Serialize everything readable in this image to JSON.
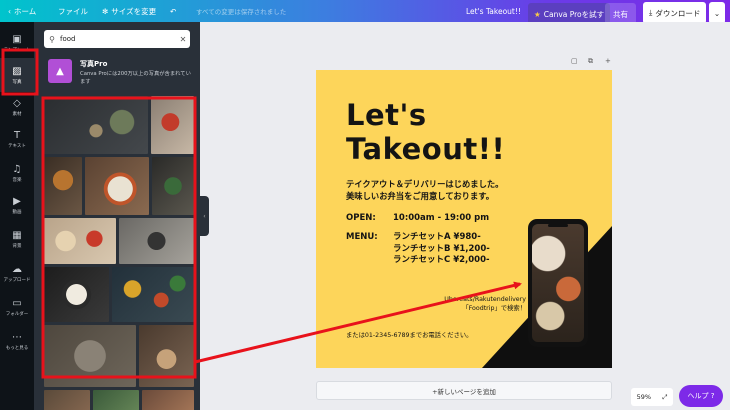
{
  "topbar": {
    "home": "ホーム",
    "file": "ファイル",
    "resize": "サイズを変更",
    "save_status": "すべての変更は保存されました",
    "doc_title": "Let's Takeout!!",
    "canva_pro": "Canva Proを試す",
    "share": "共有",
    "download": "ダウンロード"
  },
  "leftnav": {
    "items": [
      {
        "label": "テンプレート",
        "icon": "template-icon"
      },
      {
        "label": "写真",
        "icon": "photo-icon"
      },
      {
        "label": "素材",
        "icon": "elements-icon"
      },
      {
        "label": "テキスト",
        "icon": "text-icon"
      },
      {
        "label": "音楽",
        "icon": "music-icon"
      },
      {
        "label": "動画",
        "icon": "video-icon"
      },
      {
        "label": "背景",
        "icon": "background-icon"
      },
      {
        "label": "アップロード",
        "icon": "upload-icon"
      },
      {
        "label": "フォルダー",
        "icon": "folder-icon"
      },
      {
        "label": "もっと見る",
        "icon": "more-icon"
      }
    ]
  },
  "panel": {
    "search_value": "food",
    "promo_title": "写真Pro",
    "promo_desc": "Canva Proには200万以上の写真が含まれています"
  },
  "design": {
    "title_line1": "Let's",
    "title_line2": "Takeout!!",
    "intro_line1": "テイクアウト＆デリバリーはじめました。",
    "intro_line2": "美味しいお弁当をご用意しております。",
    "open_label": "OPEN:",
    "open_value": "10:00am - 19:00 pm",
    "menu_label": "MENU:",
    "menu_items": [
      "ランチセットA ¥980-",
      "ランチセットB ¥1,200-",
      "ランチセットC ¥2,000-"
    ],
    "handle_line1": "Ubereats/Rakutendelivery",
    "handle_line2": "「Foodtrip」で検索！",
    "contact": "または01-2345-6789までお電話ください。",
    "accent_color": "#fdd55a"
  },
  "canvas": {
    "add_page": "+新しいページを追加",
    "zoom": "59%",
    "help": "ヘルプ ?"
  },
  "colors": {
    "annotation": "#e8121b",
    "brand_purple": "#7d2ae8",
    "panel_bg": "#293039"
  }
}
